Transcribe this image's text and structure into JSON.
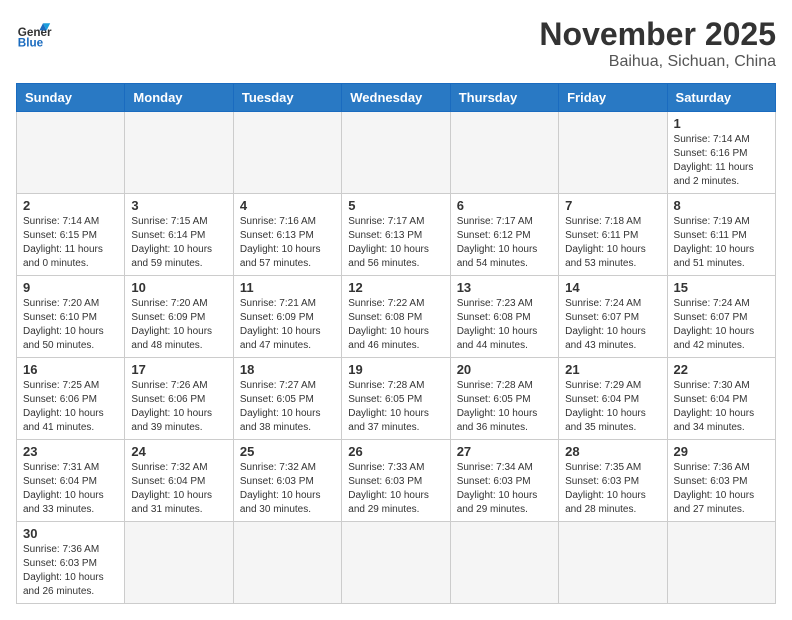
{
  "header": {
    "logo_general": "General",
    "logo_blue": "Blue",
    "month_title": "November 2025",
    "location": "Baihua, Sichuan, China"
  },
  "days_of_week": [
    "Sunday",
    "Monday",
    "Tuesday",
    "Wednesday",
    "Thursday",
    "Friday",
    "Saturday"
  ],
  "weeks": [
    [
      {
        "day": "",
        "info": ""
      },
      {
        "day": "",
        "info": ""
      },
      {
        "day": "",
        "info": ""
      },
      {
        "day": "",
        "info": ""
      },
      {
        "day": "",
        "info": ""
      },
      {
        "day": "",
        "info": ""
      },
      {
        "day": "1",
        "info": "Sunrise: 7:14 AM\nSunset: 6:16 PM\nDaylight: 11 hours and 2 minutes."
      }
    ],
    [
      {
        "day": "2",
        "info": "Sunrise: 7:14 AM\nSunset: 6:15 PM\nDaylight: 11 hours and 0 minutes."
      },
      {
        "day": "3",
        "info": "Sunrise: 7:15 AM\nSunset: 6:14 PM\nDaylight: 10 hours and 59 minutes."
      },
      {
        "day": "4",
        "info": "Sunrise: 7:16 AM\nSunset: 6:13 PM\nDaylight: 10 hours and 57 minutes."
      },
      {
        "day": "5",
        "info": "Sunrise: 7:17 AM\nSunset: 6:13 PM\nDaylight: 10 hours and 56 minutes."
      },
      {
        "day": "6",
        "info": "Sunrise: 7:17 AM\nSunset: 6:12 PM\nDaylight: 10 hours and 54 minutes."
      },
      {
        "day": "7",
        "info": "Sunrise: 7:18 AM\nSunset: 6:11 PM\nDaylight: 10 hours and 53 minutes."
      },
      {
        "day": "8",
        "info": "Sunrise: 7:19 AM\nSunset: 6:11 PM\nDaylight: 10 hours and 51 minutes."
      }
    ],
    [
      {
        "day": "9",
        "info": "Sunrise: 7:20 AM\nSunset: 6:10 PM\nDaylight: 10 hours and 50 minutes."
      },
      {
        "day": "10",
        "info": "Sunrise: 7:20 AM\nSunset: 6:09 PM\nDaylight: 10 hours and 48 minutes."
      },
      {
        "day": "11",
        "info": "Sunrise: 7:21 AM\nSunset: 6:09 PM\nDaylight: 10 hours and 47 minutes."
      },
      {
        "day": "12",
        "info": "Sunrise: 7:22 AM\nSunset: 6:08 PM\nDaylight: 10 hours and 46 minutes."
      },
      {
        "day": "13",
        "info": "Sunrise: 7:23 AM\nSunset: 6:08 PM\nDaylight: 10 hours and 44 minutes."
      },
      {
        "day": "14",
        "info": "Sunrise: 7:24 AM\nSunset: 6:07 PM\nDaylight: 10 hours and 43 minutes."
      },
      {
        "day": "15",
        "info": "Sunrise: 7:24 AM\nSunset: 6:07 PM\nDaylight: 10 hours and 42 minutes."
      }
    ],
    [
      {
        "day": "16",
        "info": "Sunrise: 7:25 AM\nSunset: 6:06 PM\nDaylight: 10 hours and 41 minutes."
      },
      {
        "day": "17",
        "info": "Sunrise: 7:26 AM\nSunset: 6:06 PM\nDaylight: 10 hours and 39 minutes."
      },
      {
        "day": "18",
        "info": "Sunrise: 7:27 AM\nSunset: 6:05 PM\nDaylight: 10 hours and 38 minutes."
      },
      {
        "day": "19",
        "info": "Sunrise: 7:28 AM\nSunset: 6:05 PM\nDaylight: 10 hours and 37 minutes."
      },
      {
        "day": "20",
        "info": "Sunrise: 7:28 AM\nSunset: 6:05 PM\nDaylight: 10 hours and 36 minutes."
      },
      {
        "day": "21",
        "info": "Sunrise: 7:29 AM\nSunset: 6:04 PM\nDaylight: 10 hours and 35 minutes."
      },
      {
        "day": "22",
        "info": "Sunrise: 7:30 AM\nSunset: 6:04 PM\nDaylight: 10 hours and 34 minutes."
      }
    ],
    [
      {
        "day": "23",
        "info": "Sunrise: 7:31 AM\nSunset: 6:04 PM\nDaylight: 10 hours and 33 minutes."
      },
      {
        "day": "24",
        "info": "Sunrise: 7:32 AM\nSunset: 6:04 PM\nDaylight: 10 hours and 31 minutes."
      },
      {
        "day": "25",
        "info": "Sunrise: 7:32 AM\nSunset: 6:03 PM\nDaylight: 10 hours and 30 minutes."
      },
      {
        "day": "26",
        "info": "Sunrise: 7:33 AM\nSunset: 6:03 PM\nDaylight: 10 hours and 29 minutes."
      },
      {
        "day": "27",
        "info": "Sunrise: 7:34 AM\nSunset: 6:03 PM\nDaylight: 10 hours and 29 minutes."
      },
      {
        "day": "28",
        "info": "Sunrise: 7:35 AM\nSunset: 6:03 PM\nDaylight: 10 hours and 28 minutes."
      },
      {
        "day": "29",
        "info": "Sunrise: 7:36 AM\nSunset: 6:03 PM\nDaylight: 10 hours and 27 minutes."
      }
    ],
    [
      {
        "day": "30",
        "info": "Sunrise: 7:36 AM\nSunset: 6:03 PM\nDaylight: 10 hours and 26 minutes."
      },
      {
        "day": "",
        "info": ""
      },
      {
        "day": "",
        "info": ""
      },
      {
        "day": "",
        "info": ""
      },
      {
        "day": "",
        "info": ""
      },
      {
        "day": "",
        "info": ""
      },
      {
        "day": "",
        "info": ""
      }
    ]
  ]
}
